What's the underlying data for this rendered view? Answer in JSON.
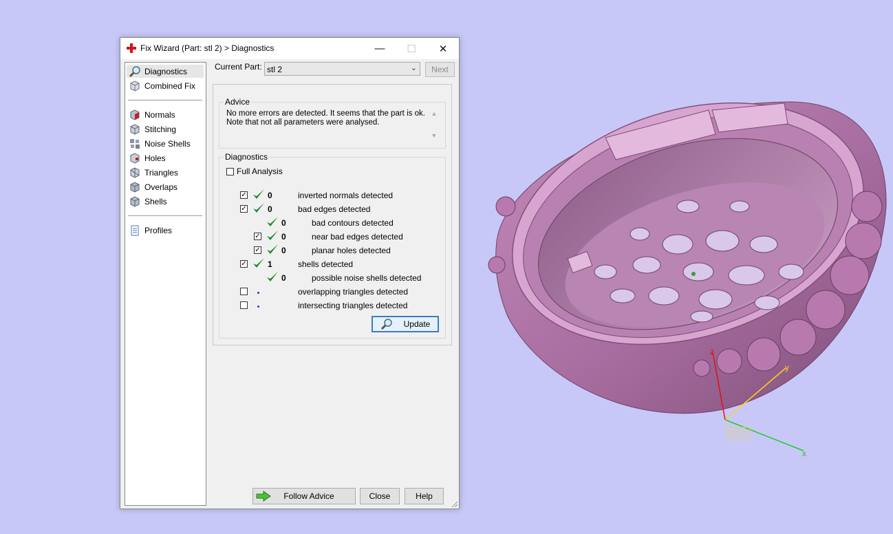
{
  "window": {
    "title": "Fix Wizard (Part: stl 2) > Diagnostics",
    "controls": {
      "minimize": "—",
      "maximize": "☐",
      "close": "✕"
    }
  },
  "sidebar": {
    "items": [
      {
        "label": "Diagnostics",
        "icon": "magnifier-icon",
        "selected": true
      },
      {
        "label": "Combined Fix",
        "icon": "cube-stack-icon"
      },
      {
        "label": "Normals",
        "icon": "normals-cube-icon"
      },
      {
        "label": "Stitching",
        "icon": "stitching-cube-icon"
      },
      {
        "label": "Noise Shells",
        "icon": "noise-shells-icon"
      },
      {
        "label": "Holes",
        "icon": "holes-cube-icon"
      },
      {
        "label": "Triangles",
        "icon": "triangles-cube-icon"
      },
      {
        "label": "Overlaps",
        "icon": "overlaps-cube-icon"
      },
      {
        "label": "Shells",
        "icon": "shells-cube-icon"
      },
      {
        "label": "Profiles",
        "icon": "document-icon"
      }
    ]
  },
  "part": {
    "label": "Current Part:",
    "value": "stl 2",
    "next_label": "Next"
  },
  "advice": {
    "title": "Advice",
    "line1": "No more errors are detected. It seems that the part is ok.",
    "line2": "Note that not all parameters were analysed."
  },
  "diagnostics": {
    "title": "Diagnostics",
    "full_analysis_label": "Full Analysis",
    "rows": [
      {
        "checked": true,
        "count": "0",
        "label": "inverted normals detected",
        "status": "ok"
      },
      {
        "checked": true,
        "count": "0",
        "label": "bad edges detected",
        "status": "ok"
      },
      {
        "checked": null,
        "count": "0",
        "label": "bad contours detected",
        "status": "ok"
      },
      {
        "checked": true,
        "count": "0",
        "label": "near bad edges detected",
        "status": "ok"
      },
      {
        "checked": true,
        "count": "0",
        "label": "planar holes detected",
        "status": "ok"
      },
      {
        "checked": true,
        "count": "1",
        "label": "shells detected",
        "status": "ok"
      },
      {
        "checked": null,
        "count": "0",
        "label": "possible noise shells detected",
        "status": "ok"
      },
      {
        "checked": false,
        "count": "",
        "label": "overlapping triangles detected",
        "status": "pending"
      },
      {
        "checked": false,
        "count": "",
        "label": "intersecting triangles detected",
        "status": "pending"
      }
    ],
    "update_label": "Update"
  },
  "footer": {
    "follow_label": "Follow Advice",
    "close_label": "Close",
    "help_label": "Help"
  },
  "viewport": {
    "axis_labels": {
      "x": "x",
      "y": "y",
      "z": "z"
    },
    "wcs_label": "WCS",
    "colors": {
      "background": "#c8c8f8",
      "model": "#c98fc0",
      "x_axis": "#22cc22",
      "y_axis": "#ffd11a",
      "z_axis": "#dd1111"
    }
  }
}
